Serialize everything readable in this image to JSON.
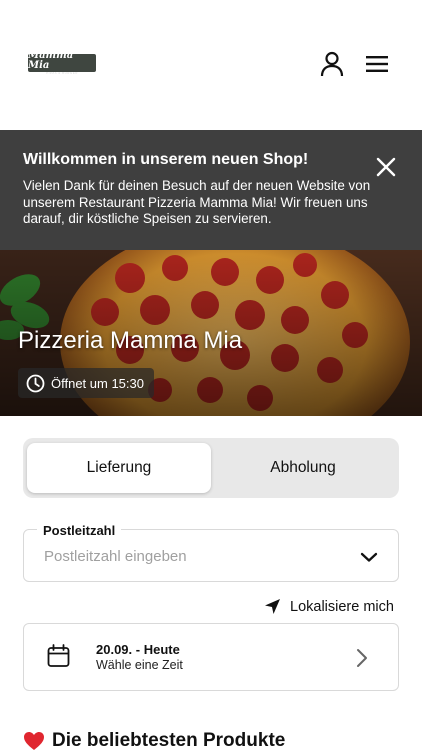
{
  "header": {
    "logo": {
      "name": "Mamma Mia",
      "tagline": "PIZZA & BURGER"
    },
    "icons": {
      "account": "user-icon",
      "menu": "hamburger-menu-icon"
    }
  },
  "banner": {
    "title": "Willkommen in unserem neuen Shop!",
    "text": "Vielen Dank für deinen Besuch auf der neuen Website von unserem Restaurant Pizzeria Mamma Mia! Wir freuen uns darauf, dir köstliche Speisen zu servieren.",
    "close_icon": "close-icon"
  },
  "hero": {
    "title": "Pizzeria Mamma Mia",
    "hours": "Öffnet um 15:30",
    "hours_icon": "clock-icon"
  },
  "order_mode": {
    "options": [
      "Lieferung",
      "Abholung"
    ],
    "selected": "Lieferung"
  },
  "postcode": {
    "label": "Postleitzahl",
    "placeholder": "Postleitzahl eingeben",
    "value": ""
  },
  "locate": {
    "label": "Lokalisiere mich",
    "icon": "navigation-arrow-icon"
  },
  "schedule": {
    "date": "20.09. - Heute",
    "hint": "Wähle eine Zeit",
    "icon": "calendar-icon"
  },
  "popular": {
    "title": "Die beliebtesten Produkte",
    "icon": "heart-icon"
  },
  "colors": {
    "banner_bg": "#3f3f3f",
    "toggle_bg": "#e8e8e8",
    "border": "#d9d9d9",
    "heart": "#e0262f"
  }
}
